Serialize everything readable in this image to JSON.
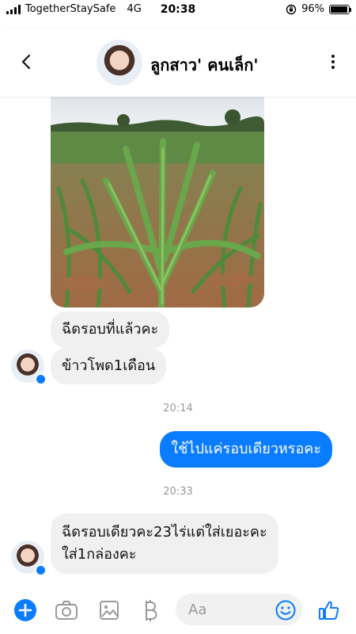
{
  "status_bar": {
    "carrier": "TogetherStaySafe",
    "network": "4G",
    "time": "20:38",
    "battery_percent": "96%",
    "battery_level": 0.96
  },
  "header": {
    "contact_name": "ลูกสาว' คนเล็ก'"
  },
  "messages": [
    {
      "text": "ฉีดรอบที่แล้วคะ"
    },
    {
      "text": "ข้าวโพด1เดือน"
    },
    {
      "text": "ใช้ไปแค่รอบเดียวหรอคะ"
    },
    {
      "line1": "ฉีดรอบเดียวคะ23ไร่แต่ใส่เยอะคะ",
      "line2": "ใส่1กล่องคะ"
    }
  ],
  "timestamps": [
    "20:14",
    "20:33"
  ],
  "composer": {
    "placeholder": "Aa"
  },
  "colors": {
    "accent": "#0a7cff",
    "incoming_bubble": "#f0f0f0",
    "timestamp": "#999999"
  }
}
